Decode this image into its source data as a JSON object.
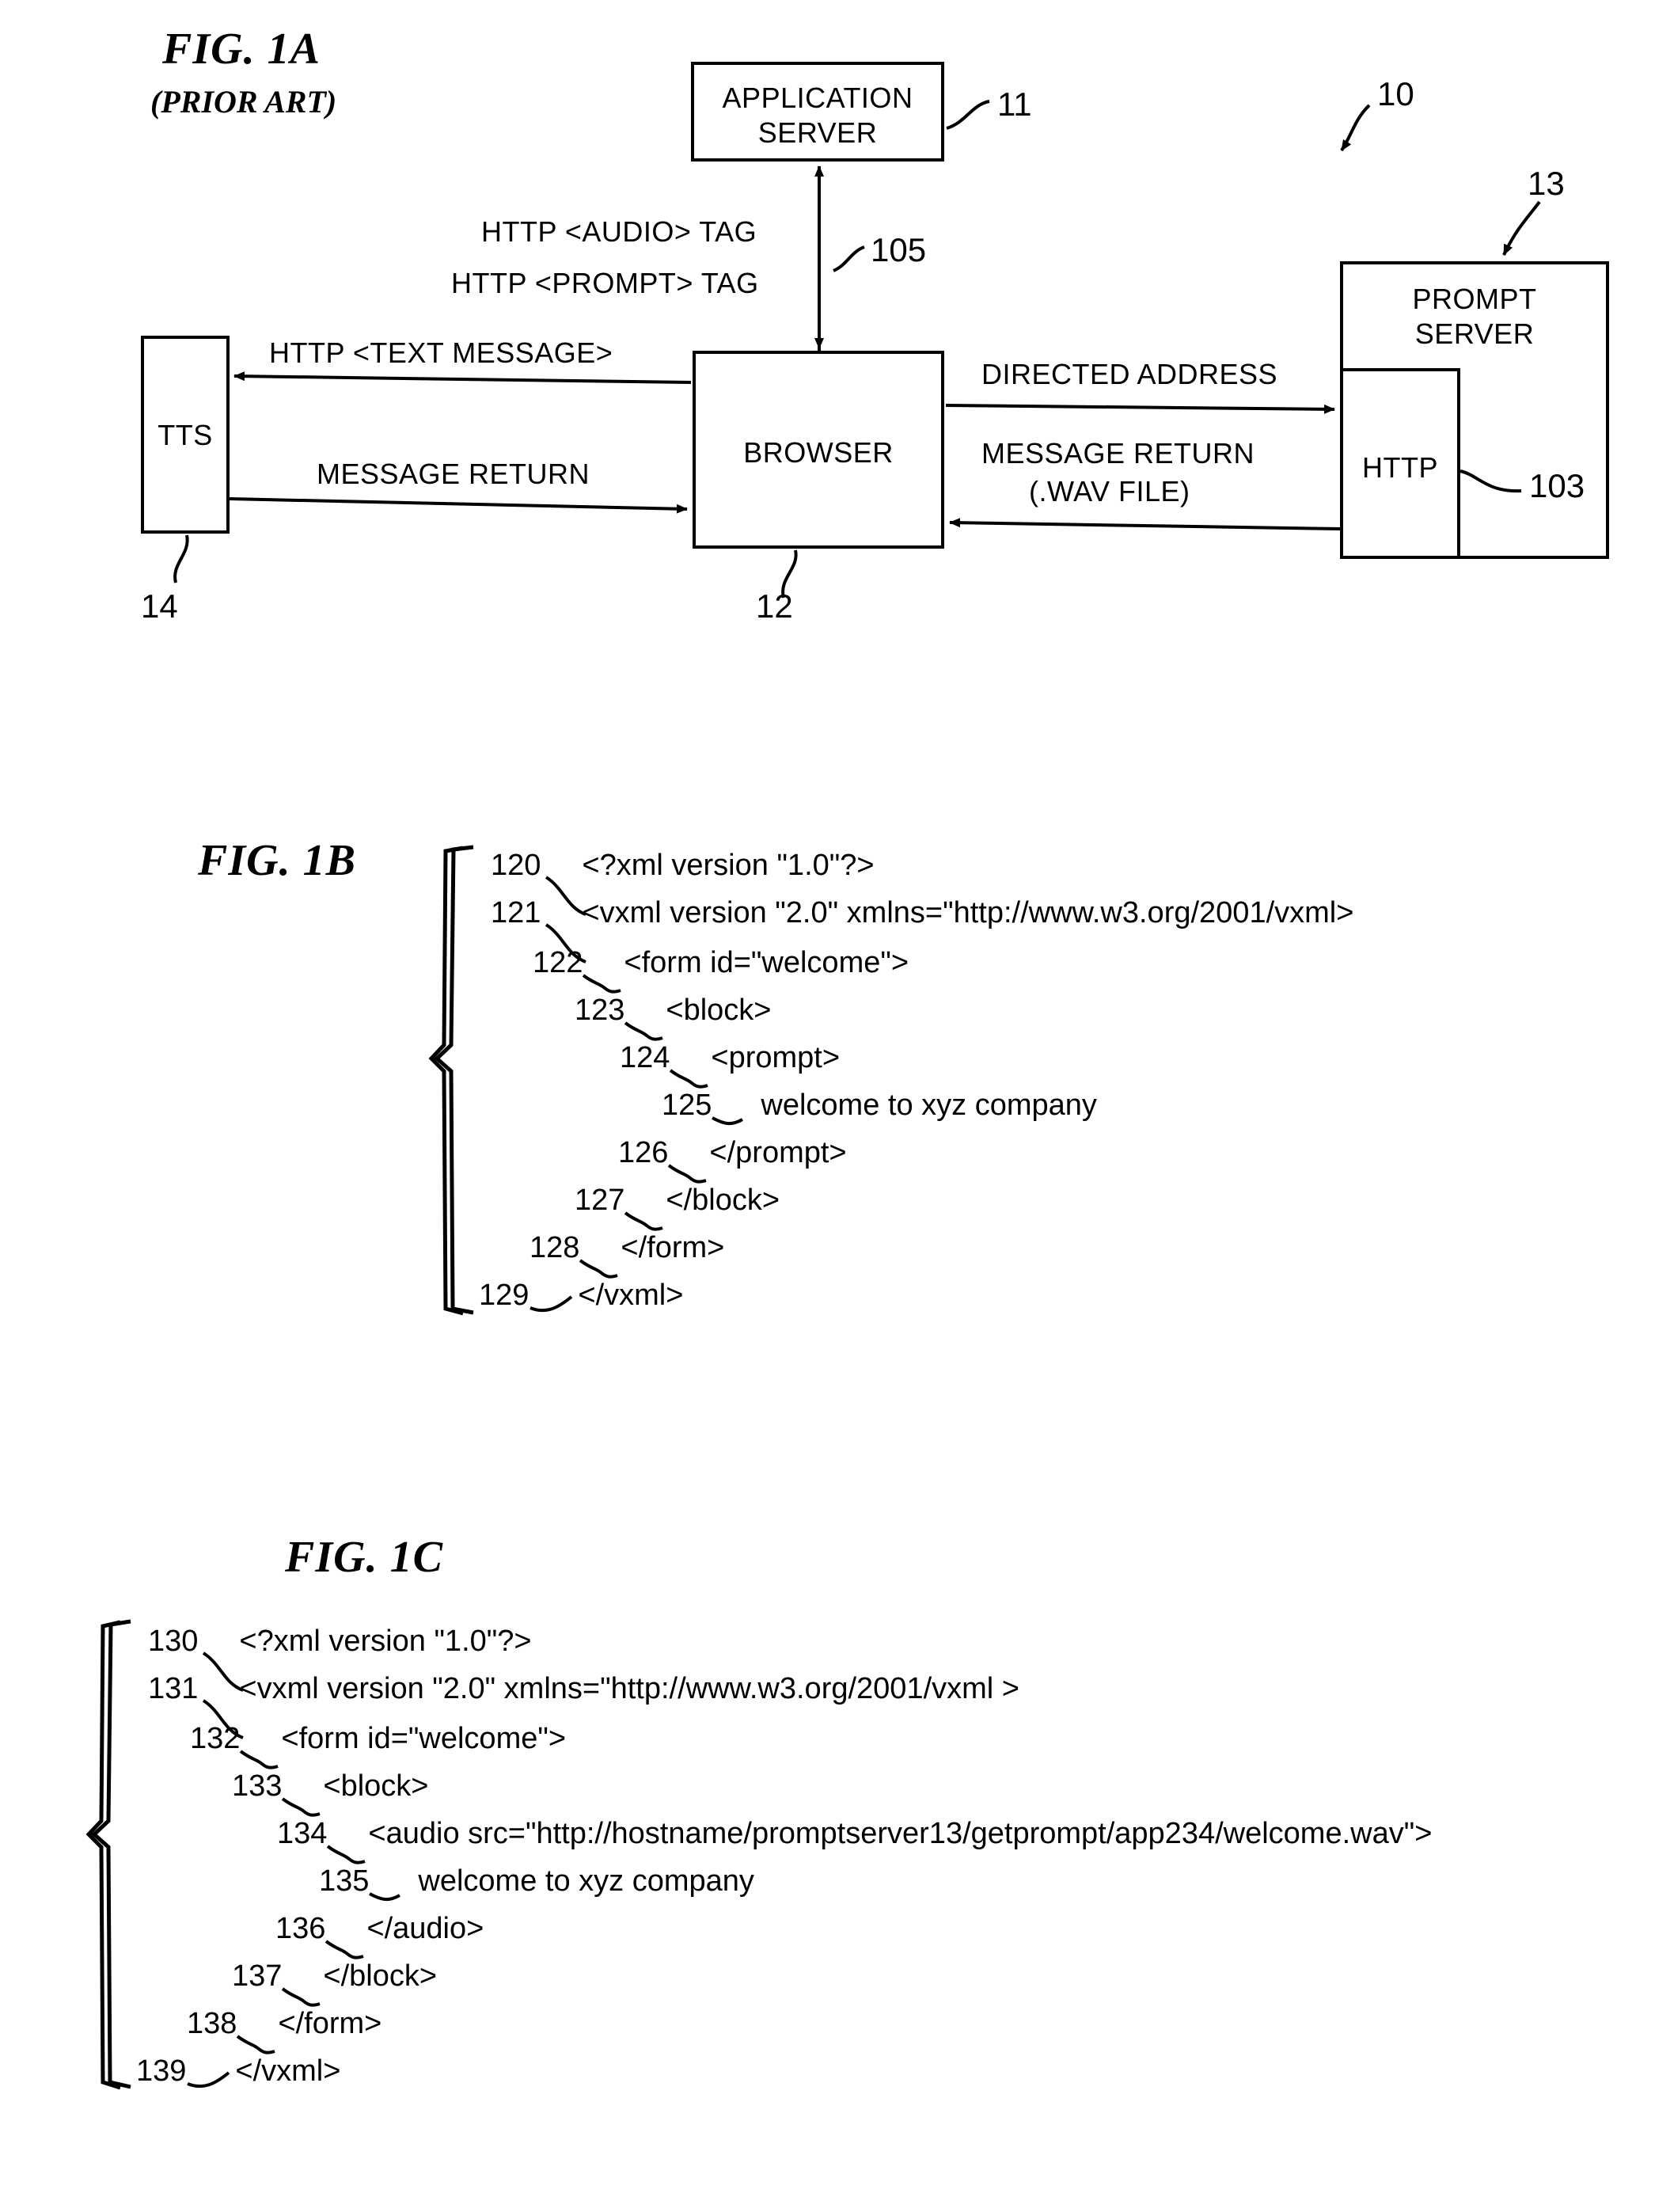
{
  "figures": {
    "fig1a": {
      "title": "FIG. 1A",
      "subtitle": "(PRIOR ART)",
      "system_ref": "10",
      "boxes": [
        {
          "id": "application-server",
          "label": "APPLICATION\nSERVER",
          "ref": "11"
        },
        {
          "id": "browser",
          "label": "BROWSER",
          "ref": "12"
        },
        {
          "id": "tts",
          "label": "TTS",
          "ref": "14"
        },
        {
          "id": "prompt-server",
          "label": "PROMPT\nSERVER",
          "ref": "13"
        },
        {
          "id": "http",
          "label": "HTTP",
          "ref": "103"
        }
      ],
      "flows": [
        {
          "id": "http-audio-tag",
          "label": "HTTP <AUDIO> TAG",
          "ref": "105"
        },
        {
          "id": "http-prompt-tag",
          "label": "HTTP <PROMPT> TAG",
          "ref": "105"
        },
        {
          "id": "http-text-message",
          "label": "HTTP <TEXT MESSAGE>"
        },
        {
          "id": "message-return-tts",
          "label": "MESSAGE RETURN"
        },
        {
          "id": "directed-address",
          "label": "DIRECTED ADDRESS"
        },
        {
          "id": "message-return-wav",
          "label": "MESSAGE RETURN\n(.WAV FILE)"
        },
        {
          "id": "message-return-wav-line1",
          "label": "MESSAGE RETURN"
        },
        {
          "id": "message-return-wav-line2",
          "label": "(.WAV FILE)"
        }
      ]
    },
    "fig1b": {
      "title": "FIG. 1B",
      "lines": [
        {
          "num": "120",
          "indent": 0,
          "code": "<?xml version \"1.0\"?>"
        },
        {
          "num": "121",
          "indent": 0,
          "code": "<vxml version \"2.0\" xmlns=\"http://www.w3.org/2001/vxml>"
        },
        {
          "num": "122",
          "indent": 1,
          "code": "<form id=\"welcome\">"
        },
        {
          "num": "123",
          "indent": 2,
          "code": "<block>"
        },
        {
          "num": "124",
          "indent": 3,
          "code": "<prompt>"
        },
        {
          "num": "125",
          "indent": 4,
          "code": "welcome to xyz company"
        },
        {
          "num": "126",
          "indent": 3,
          "code": "</prompt>"
        },
        {
          "num": "127",
          "indent": 2,
          "code": "</block>"
        },
        {
          "num": "128",
          "indent": 1,
          "code": "</form>"
        },
        {
          "num": "129",
          "indent": 0,
          "code": "</vxml>"
        }
      ]
    },
    "fig1c": {
      "title": "FIG. 1C",
      "lines": [
        {
          "num": "130",
          "indent": 0,
          "code": "<?xml version \"1.0\"?>"
        },
        {
          "num": "131",
          "indent": 0,
          "code": "<vxml version \"2.0\" xmlns=\"http://www.w3.org/2001/vxml >"
        },
        {
          "num": "132",
          "indent": 1,
          "code": "<form id=\"welcome\">"
        },
        {
          "num": "133",
          "indent": 2,
          "code": "<block>"
        },
        {
          "num": "134",
          "indent": 3,
          "code": "<audio src=\"http://hostname/promptserver13/getprompt/app234/welcome.wav\">"
        },
        {
          "num": "135",
          "indent": 4,
          "code": "welcome to xyz company"
        },
        {
          "num": "136",
          "indent": 3,
          "code": "</audio>"
        },
        {
          "num": "137",
          "indent": 2,
          "code": "</block>"
        },
        {
          "num": "138",
          "indent": 1,
          "code": "</form>"
        },
        {
          "num": "139",
          "indent": 0,
          "code": "</vxml>"
        }
      ]
    }
  }
}
